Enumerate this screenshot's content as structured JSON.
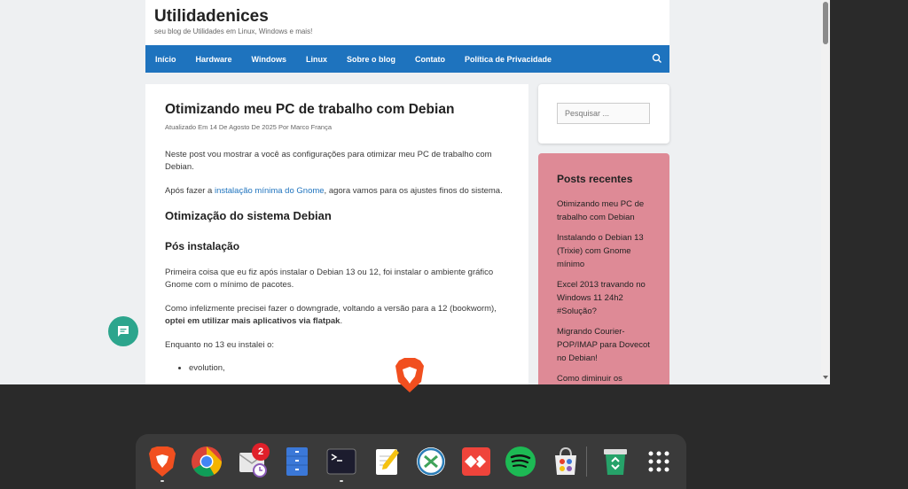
{
  "site": {
    "title": "Utilidadenices",
    "tagline": "seu blog de Utilidades em Linux, Windows e mais!"
  },
  "nav": {
    "items": [
      "Início",
      "Hardware",
      "Windows",
      "Linux",
      "Sobre o blog",
      "Contato",
      "Política de Privacidade"
    ],
    "search_icon": "search-icon"
  },
  "post": {
    "title": "Otimizando meu PC de trabalho com Debian",
    "meta": "Atualizado Em 14 De Agosto De 2025 Por Marco França",
    "intro": "Neste post vou mostrar a você as configurações para otimizar meu PC de trabalho com Debian.",
    "para2_before": "Após fazer a ",
    "para2_link": "instalação mínima do Gnome",
    "para2_after": ", agora vamos para os ajustes finos do sistema.",
    "h2": "Otimização do sistema Debian",
    "h3": "Pós instalação",
    "para3": "Primeira coisa que eu fiz após instalar o Debian 13 ou 12, foi instalar o ambiente gráfico Gnome com o mínimo de pacotes.",
    "para4_before": "Como infelizmente precisei fazer o downgrade, voltando a versão para a 12 (bookworm), ",
    "para4_bold": "optei em utilizar mais aplicativos via flatpak",
    "para4_after": ".",
    "para5": "Enquanto no 13 eu instalei o:",
    "bullets": [
      "evolution,"
    ]
  },
  "sidebar": {
    "search_placeholder": "Pesquisar ...",
    "recent_title": "Posts recentes",
    "recent_posts": [
      "Otimizando meu PC de trabalho com Debian",
      "Instalando o Debian 13 (Trixie) com Gnome mínimo",
      "Excel 2013 travando no Windows 11 24h2 #Solução?",
      "Migrando Courier-POP/IMAP para Dovecot no Debian!",
      "Como diminuir os"
    ]
  },
  "dock": {
    "apps": [
      "brave-browser-icon",
      "chrome-icon",
      "mail-client-icon",
      "file-manager-icon",
      "terminal-icon",
      "text-editor-icon",
      "remote-desktop-icon",
      "anydesk-icon",
      "spotify-icon",
      "software-store-icon",
      "trash-icon",
      "app-grid-icon"
    ],
    "mail_badge": "2"
  },
  "colors": {
    "nav_bg": "#1e73be",
    "recent_widget_bg": "#de8a96",
    "chat_button": "#2ca58d",
    "badge": "#e0202a"
  }
}
